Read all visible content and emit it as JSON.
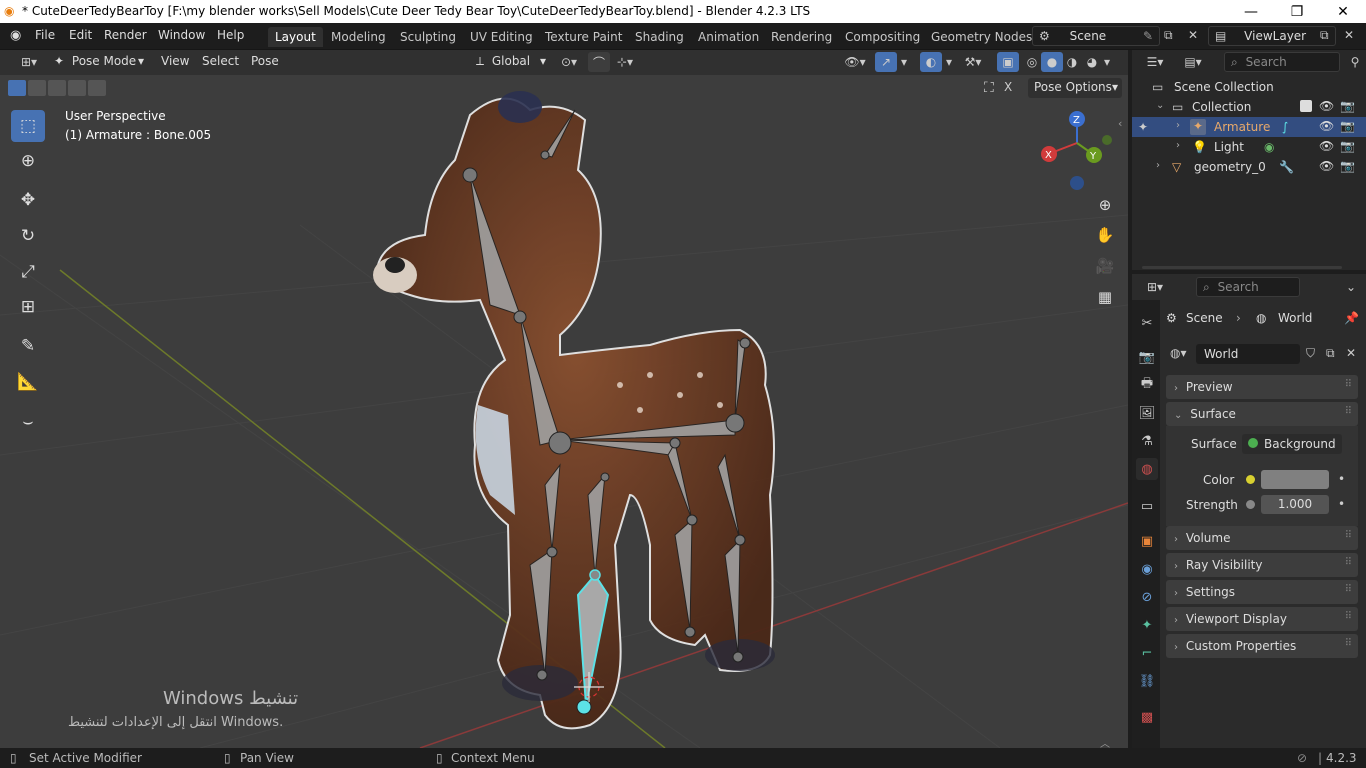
{
  "window": {
    "title": "* CuteDeerTedyBearToy [F:\\my blender works\\Sell Models\\Cute Deer Tedy Bear Toy\\CuteDeerTedyBearToy.blend] - Blender 4.2.3 LTS"
  },
  "menubar": {
    "items": [
      "File",
      "Edit",
      "Render",
      "Window",
      "Help"
    ]
  },
  "workspaces": [
    "Layout",
    "Modeling",
    "Sculpting",
    "UV Editing",
    "Texture Paint",
    "Shading",
    "Animation",
    "Rendering",
    "Compositing",
    "Geometry Nodes"
  ],
  "scene_selector": "Scene",
  "viewlayer_selector": "ViewLayer",
  "viewport_header": {
    "mode": "Pose Mode",
    "menus": [
      "View",
      "Select",
      "Pose"
    ],
    "orientation": "Global",
    "pose_options": "Pose Options"
  },
  "viewport": {
    "perspective": "User Perspective",
    "active": "(1) Armature : Bone.005",
    "watermark_title": "Windows تنشيط",
    "watermark_sub": "انتقل إلى الإعدادات لتنشيط Windows."
  },
  "outliner": {
    "search_placeholder": "Search",
    "rows": [
      {
        "label": "Scene Collection"
      },
      {
        "label": "Collection"
      },
      {
        "label": "Armature"
      },
      {
        "label": "Light"
      },
      {
        "label": "geometry_0"
      }
    ]
  },
  "properties": {
    "search_placeholder": "Search",
    "breadcrumb_scene": "Scene",
    "breadcrumb_world": "World",
    "world_name": "World",
    "panels": {
      "preview": "Preview",
      "surface": "Surface",
      "volume": "Volume",
      "ray_visibility": "Ray Visibility",
      "settings": "Settings",
      "viewport_display": "Viewport Display",
      "custom_properties": "Custom Properties"
    },
    "surface_label": "Surface",
    "surface_value": "Background",
    "color_label": "Color",
    "strength_label": "Strength",
    "strength_value": "1.000"
  },
  "statusbar": {
    "left": "Set Active Modifier",
    "middle": "Pan View",
    "right": "Context Menu",
    "version": "4.2.3"
  },
  "colors": {
    "accent": "#4772b3",
    "selected_row": "#334d80",
    "active_bone": "#5ce1e6",
    "armature_orange": "#e8a96a"
  }
}
